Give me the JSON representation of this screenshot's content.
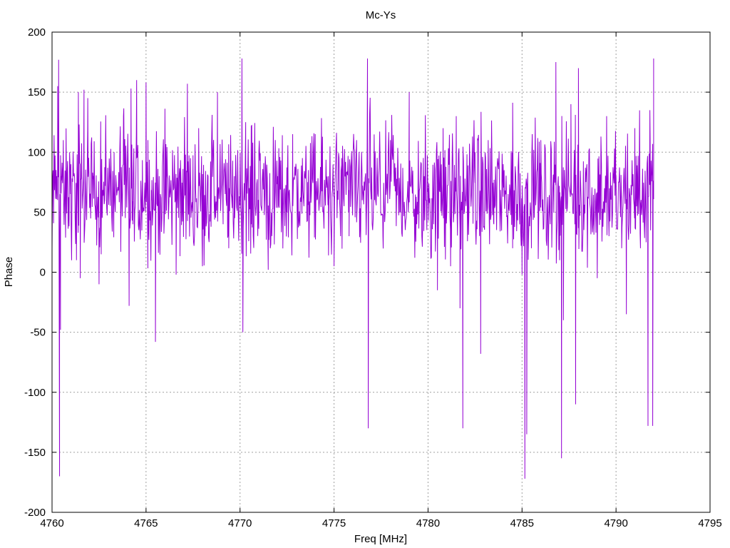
{
  "chart_data": {
    "type": "line",
    "title": "Mc-Ys",
    "xlabel": "Freq [MHz]",
    "ylabel": "Phase",
    "xlim": [
      4760,
      4795
    ],
    "ylim": [
      -200,
      200
    ],
    "x_ticks": [
      4760,
      4765,
      4770,
      4775,
      4780,
      4785,
      4790,
      4795
    ],
    "y_ticks": [
      -200,
      -150,
      -100,
      -50,
      0,
      50,
      100,
      150,
      200
    ],
    "x_tick_labels": [
      "4760",
      "4765",
      "4770",
      "4775",
      "4780",
      "4785",
      "4790",
      "4795"
    ],
    "y_tick_labels": [
      "-200",
      "-150",
      "-100",
      "-50",
      "0",
      "50",
      "100",
      "150",
      "200"
    ],
    "grid": true,
    "series_color": "#9400d3",
    "series": [
      {
        "name": "",
        "x_start": 4760.0,
        "x_end": 4792.0,
        "anchor_points": [
          [
            4760.0,
            20
          ],
          [
            4760.1,
            100
          ],
          [
            4760.25,
            80
          ],
          [
            4760.3,
            155
          ],
          [
            4760.35,
            177
          ],
          [
            4760.4,
            -170
          ],
          [
            4760.45,
            -48
          ],
          [
            4760.5,
            80
          ],
          [
            4760.6,
            110
          ],
          [
            4760.7,
            60
          ],
          [
            4761.0,
            90
          ],
          [
            4761.3,
            10
          ],
          [
            4761.4,
            150
          ],
          [
            4761.5,
            -5
          ],
          [
            4761.7,
            152
          ],
          [
            4761.9,
            145
          ],
          [
            4762.2,
            80
          ],
          [
            4762.5,
            -10
          ],
          [
            4762.8,
            60
          ],
          [
            4763.3,
            100
          ],
          [
            4763.8,
            130
          ],
          [
            4764.1,
            -28
          ],
          [
            4764.2,
            153
          ],
          [
            4764.3,
            40
          ],
          [
            4764.5,
            160
          ],
          [
            4764.8,
            70
          ],
          [
            4765.0,
            158
          ],
          [
            4765.1,
            110
          ],
          [
            4765.3,
            60
          ],
          [
            4765.5,
            -58
          ],
          [
            4765.7,
            80
          ],
          [
            4766.0,
            100
          ],
          [
            4766.4,
            60
          ],
          [
            4766.6,
            -2
          ],
          [
            4766.8,
            80
          ],
          [
            4767.0,
            60
          ],
          [
            4767.2,
            157
          ],
          [
            4767.5,
            40
          ],
          [
            4767.8,
            120
          ],
          [
            4768.0,
            5
          ],
          [
            4768.3,
            80
          ],
          [
            4768.8,
            150
          ],
          [
            4769.1,
            40
          ],
          [
            4769.4,
            20
          ],
          [
            4769.7,
            80
          ],
          [
            4770.0,
            90
          ],
          [
            4770.1,
            178
          ],
          [
            4770.15,
            -50
          ],
          [
            4770.3,
            125
          ],
          [
            4770.6,
            40
          ],
          [
            4771.0,
            100
          ],
          [
            4771.5,
            2
          ],
          [
            4772.0,
            80
          ],
          [
            4772.5,
            50
          ],
          [
            4772.8,
            115
          ],
          [
            4773.2,
            60
          ],
          [
            4773.6,
            75
          ],
          [
            4774.0,
            115
          ],
          [
            4774.4,
            50
          ],
          [
            4774.7,
            80
          ],
          [
            4775.0,
            5
          ],
          [
            4775.4,
            95
          ],
          [
            4775.8,
            30
          ],
          [
            4776.2,
            110
          ],
          [
            4776.5,
            60
          ],
          [
            4776.78,
            178
          ],
          [
            4776.82,
            -130
          ],
          [
            4777.2,
            80
          ],
          [
            4777.6,
            30
          ],
          [
            4778.0,
            110
          ],
          [
            4778.5,
            50
          ],
          [
            4779.0,
            150
          ],
          [
            4779.4,
            40
          ],
          [
            4779.8,
            80
          ],
          [
            4780.0,
            70
          ],
          [
            4780.3,
            40
          ],
          [
            4780.5,
            -15
          ],
          [
            4780.8,
            120
          ],
          [
            4781.2,
            5
          ],
          [
            4781.5,
            130
          ],
          [
            4781.7,
            -30
          ],
          [
            4781.85,
            -130
          ],
          [
            4782.0,
            60
          ],
          [
            4782.5,
            100
          ],
          [
            4782.8,
            -68
          ],
          [
            4783.2,
            110
          ],
          [
            4783.5,
            40
          ],
          [
            4784.0,
            90
          ],
          [
            4784.5,
            20
          ],
          [
            4784.9,
            60
          ],
          [
            4785.0,
            -2
          ],
          [
            4785.15,
            -172
          ],
          [
            4785.25,
            -135
          ],
          [
            4785.5,
            20
          ],
          [
            4786.0,
            110
          ],
          [
            4786.5,
            40
          ],
          [
            4786.8,
            175
          ],
          [
            4787.0,
            10
          ],
          [
            4787.1,
            -155
          ],
          [
            4787.2,
            -40
          ],
          [
            4787.6,
            140
          ],
          [
            4787.85,
            -110
          ],
          [
            4788.0,
            170
          ],
          [
            4788.5,
            60
          ],
          [
            4789.0,
            -5
          ],
          [
            4789.5,
            130
          ],
          [
            4790.0,
            80
          ],
          [
            4790.3,
            20
          ],
          [
            4790.55,
            -35
          ],
          [
            4790.7,
            70
          ],
          [
            4791.0,
            120
          ],
          [
            4791.3,
            20
          ],
          [
            4791.6,
            25
          ],
          [
            4791.7,
            -128
          ],
          [
            4791.8,
            135
          ],
          [
            4791.9,
            80
          ],
          [
            4791.95,
            -128
          ],
          [
            4792.0,
            178
          ]
        ],
        "baseline": 65,
        "noise_amplitude": 35,
        "sample_count": 1200
      }
    ]
  }
}
